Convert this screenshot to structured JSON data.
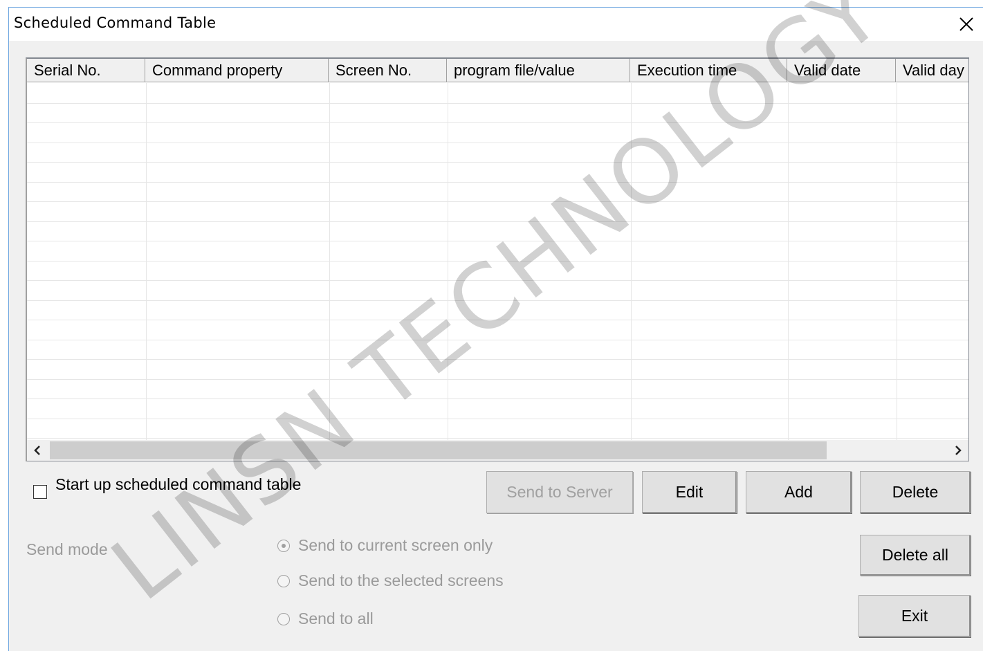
{
  "window": {
    "title": "Scheduled Command Table"
  },
  "table": {
    "columns": [
      "Serial No.",
      "Command property",
      "Screen No.",
      "program file/value",
      "Execution time",
      "Valid date",
      "Valid day"
    ],
    "rows": []
  },
  "options": {
    "startup_label": "Start up scheduled command table",
    "startup_checked": false
  },
  "buttons": {
    "send_to_server": "Send to Server",
    "edit": "Edit",
    "add": "Add",
    "delete": "Delete",
    "delete_all": "Delete all",
    "exit": "Exit"
  },
  "send_mode": {
    "label": "Send mode",
    "options": [
      "Send to current screen only",
      "Send to the selected screens",
      "Send to all"
    ],
    "selected": "Send to current screen only"
  },
  "watermark": "LINSN TECHNOLOGY",
  "icons": {
    "close": "close-icon",
    "scroll_left": "chevron-left-icon",
    "scroll_right": "chevron-right-icon"
  }
}
